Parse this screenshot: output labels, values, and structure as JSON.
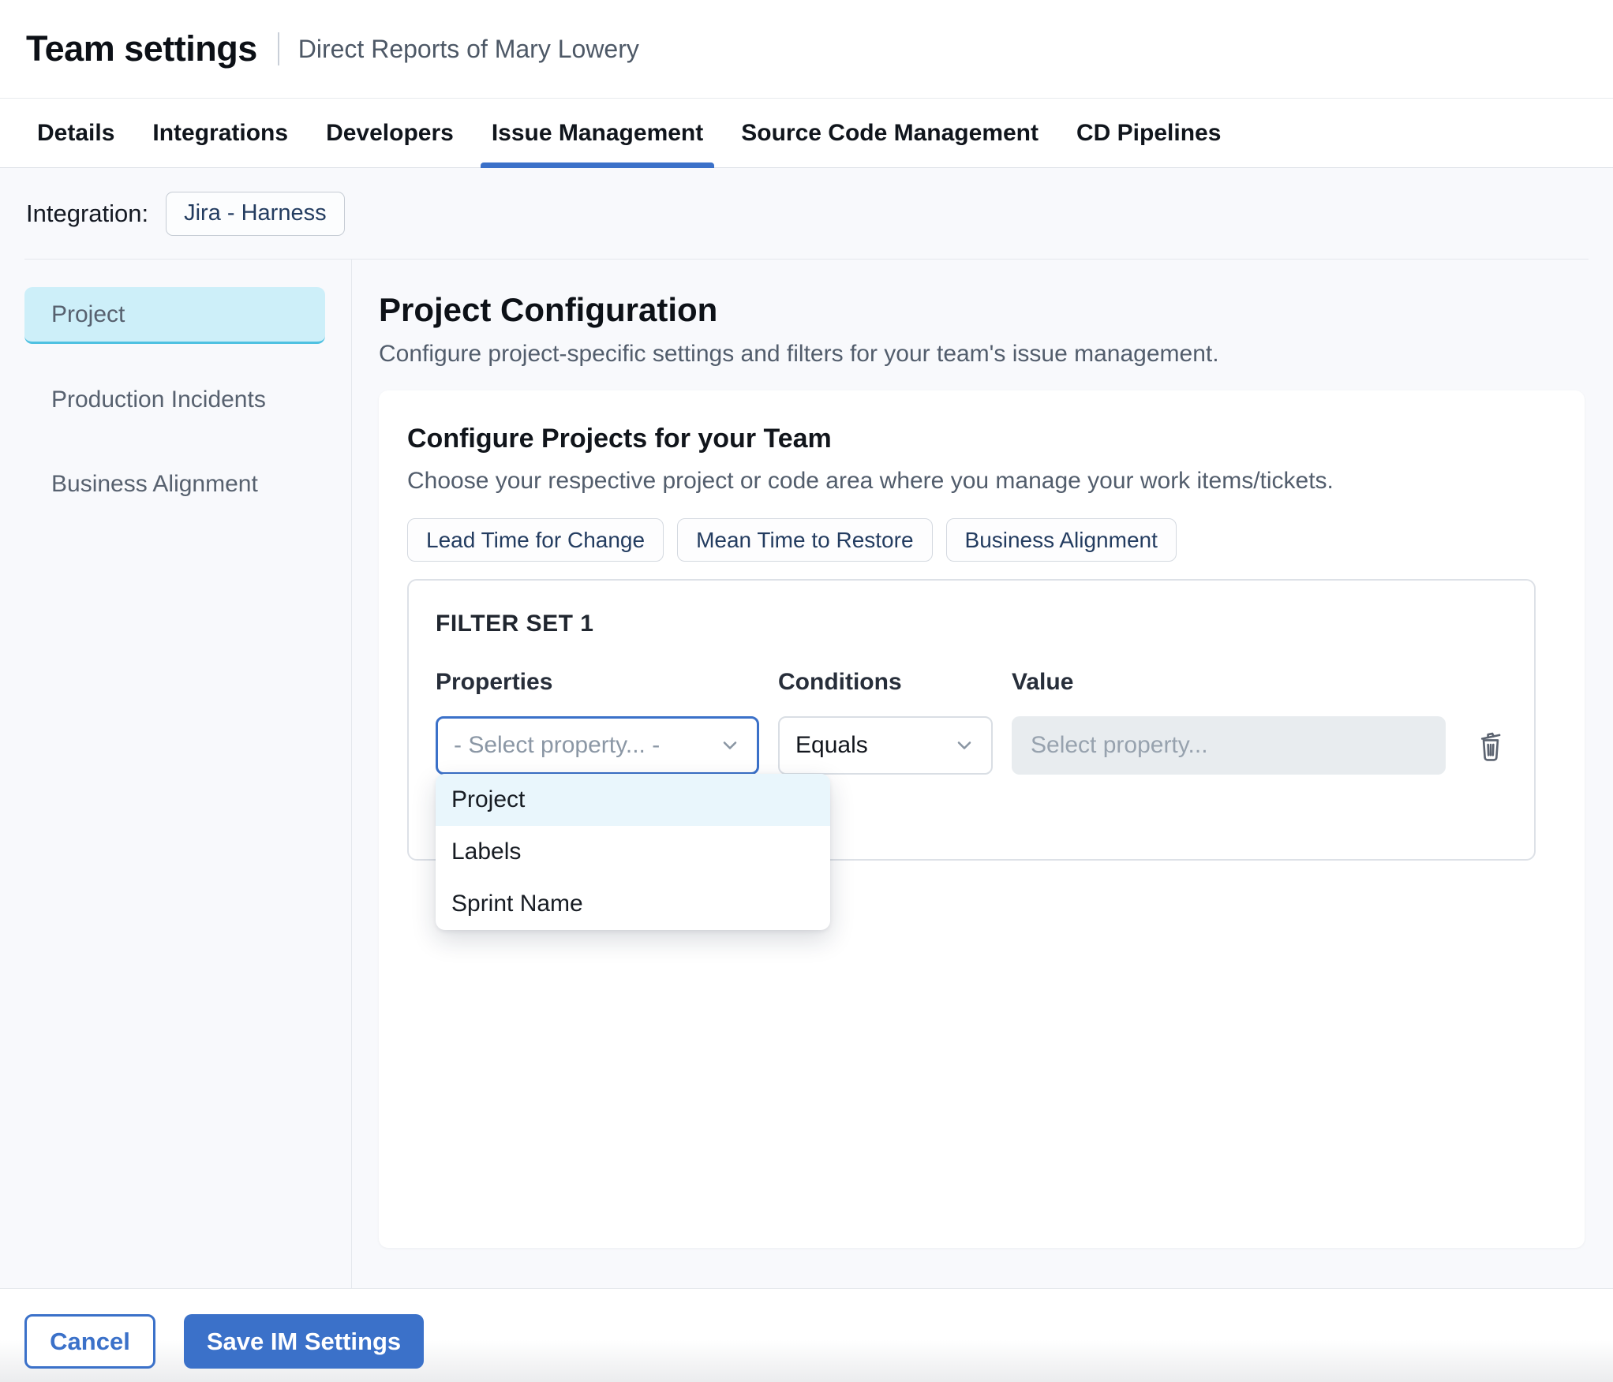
{
  "header": {
    "title": "Team settings",
    "subtitle": "Direct Reports of Mary Lowery"
  },
  "tabs": [
    {
      "label": "Details",
      "active": false
    },
    {
      "label": "Integrations",
      "active": false
    },
    {
      "label": "Developers",
      "active": false
    },
    {
      "label": "Issue Management",
      "active": true
    },
    {
      "label": "Source Code Management",
      "active": false
    },
    {
      "label": "CD Pipelines",
      "active": false
    }
  ],
  "integration": {
    "label": "Integration:",
    "chip": "Jira - Harness"
  },
  "sidebar": {
    "items": [
      {
        "label": "Project",
        "active": true
      },
      {
        "label": "Production Incidents",
        "active": false
      },
      {
        "label": "Business Alignment",
        "active": false
      }
    ]
  },
  "main": {
    "title": "Project Configuration",
    "subtitle": "Configure project-specific settings and filters for your team's issue management.",
    "card": {
      "title": "Configure Projects for your Team",
      "subtitle": "Choose your respective project or code area where you manage your work items/tickets.",
      "chips": [
        {
          "label": "Lead Time for Change"
        },
        {
          "label": "Mean Time to Restore"
        },
        {
          "label": "Business Alignment"
        }
      ],
      "filter_set": {
        "title": "FILTER SET 1",
        "columns": [
          {
            "label": "Properties"
          },
          {
            "label": "Conditions"
          },
          {
            "label": "Value"
          }
        ],
        "property_placeholder": "- Select property... -",
        "condition_value": "Equals",
        "value_placeholder": "Select property...",
        "dropdown": {
          "options": [
            {
              "label": "Project",
              "highlighted": true
            },
            {
              "label": "Labels",
              "highlighted": false
            },
            {
              "label": "Sprint Name",
              "highlighted": false
            }
          ]
        }
      }
    }
  },
  "footer": {
    "cancel_label": "Cancel",
    "save_label": "Save IM Settings"
  },
  "colors": {
    "accent": "#3b71c9",
    "page_bg": "#f8f9fc",
    "chip_text": "#233c60",
    "side_active_bg": "#cdeff9",
    "side_active_border": "#4fc1e1",
    "dd_highlight": "#e9f6fc"
  }
}
